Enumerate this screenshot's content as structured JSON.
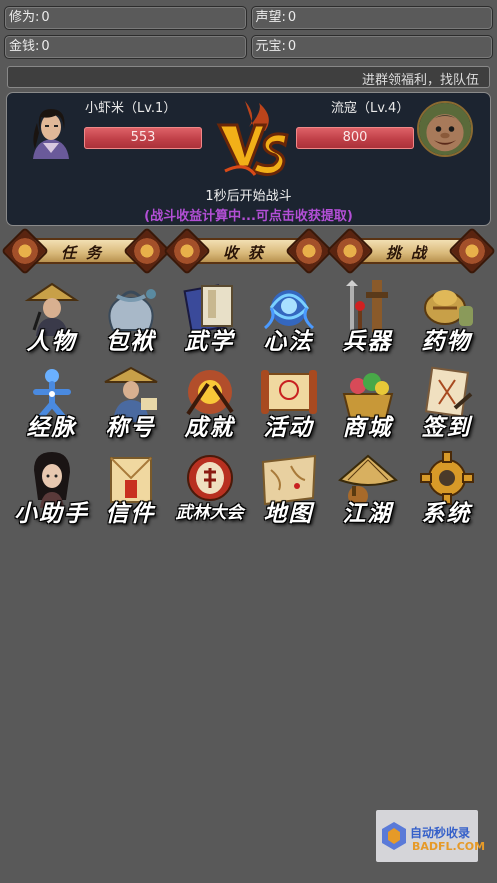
{
  "stats": {
    "cultivation": {
      "label": "修为:",
      "value": "0"
    },
    "reputation": {
      "label": "声望:",
      "value": "0"
    },
    "gold": {
      "label": "金钱:",
      "value": "0"
    },
    "ingot": {
      "label": "元宝:",
      "value": "0"
    }
  },
  "marquee": "进群领福利，找队伍",
  "battle": {
    "player": {
      "name": "小虾米（Lv.1）",
      "hp": "553"
    },
    "enemy": {
      "name": "流寇（Lv.4）",
      "hp": "800"
    },
    "countdown": "1秒后开始战斗",
    "earnings_tip": "(战斗收益计算中...可点击收获提取)"
  },
  "tabs": [
    {
      "label": "任务"
    },
    {
      "label": "收获"
    },
    {
      "label": "挑战"
    }
  ],
  "menu": [
    {
      "label": "人物",
      "icon": "character-icon"
    },
    {
      "label": "包袱",
      "icon": "bag-icon"
    },
    {
      "label": "武学",
      "icon": "martial-book-icon"
    },
    {
      "label": "心法",
      "icon": "mind-art-icon"
    },
    {
      "label": "兵器",
      "icon": "weapon-icon"
    },
    {
      "label": "药物",
      "icon": "medicine-icon"
    },
    {
      "label": "经脉",
      "icon": "meridian-icon"
    },
    {
      "label": "称号",
      "icon": "title-icon"
    },
    {
      "label": "成就",
      "icon": "achievement-icon"
    },
    {
      "label": "活动",
      "icon": "event-scroll-icon"
    },
    {
      "label": "商城",
      "icon": "treasure-shop-icon"
    },
    {
      "label": "签到",
      "icon": "sign-in-icon"
    },
    {
      "label": "小助手",
      "icon": "assistant-icon"
    },
    {
      "label": "信件",
      "icon": "letter-icon"
    },
    {
      "label": "武林大会",
      "icon": "tournament-drum-icon"
    },
    {
      "label": "地图",
      "icon": "map-icon"
    },
    {
      "label": "江湖",
      "icon": "jianghu-hat-icon"
    },
    {
      "label": "系统",
      "icon": "settings-gear-icon"
    }
  ],
  "watermark": {
    "line1": "自动秒收录",
    "line2": "BADFL.COM"
  },
  "colors": {
    "background": "#595959",
    "hp_bar": "#c04048",
    "tip": "#b34fd6",
    "panel": "#1c2430"
  }
}
